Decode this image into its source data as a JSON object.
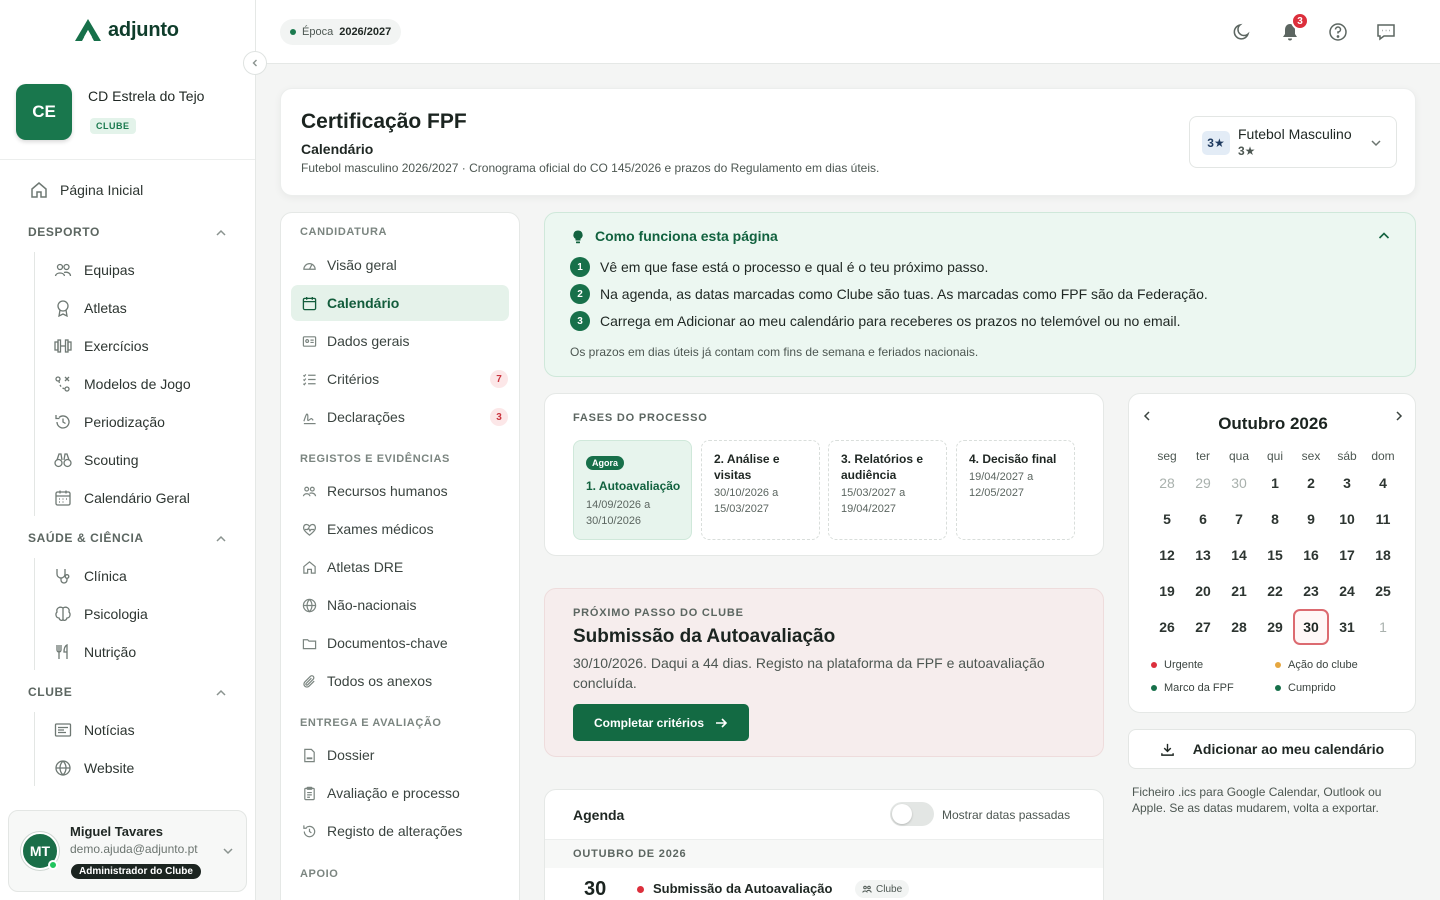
{
  "app": {
    "name": "adjunto"
  },
  "club": {
    "initials": "CE",
    "name": "CD Estrela do Tejo",
    "type": "CLUBE"
  },
  "sidebar": {
    "home": "Página Inicial",
    "sections": [
      {
        "title": "DESPORTO",
        "items": [
          "Equipas",
          "Atletas",
          "Exercícios",
          "Modelos de Jogo",
          "Periodização",
          "Scouting",
          "Calendário Geral"
        ]
      },
      {
        "title": "SAÚDE & CIÊNCIA",
        "items": [
          "Clínica",
          "Psicologia",
          "Nutrição"
        ]
      },
      {
        "title": "CLUBE",
        "items": [
          "Notícias",
          "Website"
        ]
      }
    ]
  },
  "user": {
    "initials": "MT",
    "name": "Miguel Tavares",
    "email": "demo.ajuda@adjunto.pt",
    "role": "Administrador do Clube"
  },
  "topbar": {
    "season_label": "Época",
    "season_value": "2026/2027",
    "notifications": "3"
  },
  "header": {
    "title": "Certificação FPF",
    "subtitle": "Calendário",
    "description": "Futebol masculino 2026/2027 · Cronograma oficial do CO 145/2026 e prazos do Regulamento em dias úteis.",
    "team_badge": "3★",
    "team_name": "Futebol Masculino",
    "team_stars": "3★"
  },
  "subnav": {
    "sections": [
      {
        "title": "CANDIDATURA",
        "items": [
          {
            "label": "Visão geral"
          },
          {
            "label": "Calendário",
            "active": true
          },
          {
            "label": "Dados gerais"
          },
          {
            "label": "Critérios",
            "count": "7"
          },
          {
            "label": "Declarações",
            "count": "3"
          }
        ]
      },
      {
        "title": "REGISTOS E EVIDÊNCIAS",
        "items": [
          {
            "label": "Recursos humanos"
          },
          {
            "label": "Exames médicos"
          },
          {
            "label": "Atletas DRE"
          },
          {
            "label": "Não-nacionais"
          },
          {
            "label": "Documentos-chave"
          },
          {
            "label": "Todos os anexos"
          }
        ]
      },
      {
        "title": "ENTREGA E AVALIAÇÃO",
        "items": [
          {
            "label": "Dossier"
          },
          {
            "label": "Avaliação e processo"
          },
          {
            "label": "Registo de alterações"
          }
        ]
      },
      {
        "title": "APOIO",
        "items": []
      }
    ]
  },
  "info": {
    "title": "Como funciona esta página",
    "steps": [
      "Vê em que fase está o processo e qual é o teu próximo passo.",
      "Na agenda, as datas marcadas como Clube são tuas. As marcadas como FPF são da Federação.",
      "Carrega em Adicionar ao meu calendário para receberes os prazos no telemóvel ou no email."
    ],
    "note": "Os prazos em dias úteis já contam com fins de semana e feriados nacionais."
  },
  "phases": {
    "label": "FASES DO PROCESSO",
    "current_tag": "Agora",
    "items": [
      {
        "title": "1. Autoavaliação",
        "dates": "14/09/2026 a 30/10/2026",
        "current": true
      },
      {
        "title": "2. Análise e visitas",
        "dates": "30/10/2026 a 15/03/2027"
      },
      {
        "title": "3. Relatórios e audiência",
        "dates": "15/03/2027 a 19/04/2027"
      },
      {
        "title": "4. Decisão final",
        "dates": "19/04/2027 a 12/05/2027"
      }
    ]
  },
  "next_step": {
    "label": "PRÓXIMO PASSO DO CLUBE",
    "title": "Submissão da Autoavaliação",
    "description": "30/10/2026. Daqui a 44 dias. Registo na plataforma da FPF e autoavaliação concluída.",
    "button": "Completar critérios"
  },
  "agenda": {
    "title": "Agenda",
    "toggle_label": "Mostrar datas passadas",
    "toggle_on": false,
    "month_label": "OUTUBRO DE 2026",
    "events": [
      {
        "day": "30",
        "title": "Submissão da Autoavaliação",
        "tag": "Clube",
        "color": "#dc2f3c"
      }
    ]
  },
  "calendar": {
    "month": "Outubro 2026",
    "weekdays": [
      "seg",
      "ter",
      "qua",
      "qui",
      "sex",
      "sáb",
      "dom"
    ],
    "weeks": [
      [
        "28",
        "29",
        "30",
        "1",
        "2",
        "3",
        "4"
      ],
      [
        "5",
        "6",
        "7",
        "8",
        "9",
        "10",
        "11"
      ],
      [
        "12",
        "13",
        "14",
        "15",
        "16",
        "17",
        "18"
      ],
      [
        "19",
        "20",
        "21",
        "22",
        "23",
        "24",
        "25"
      ],
      [
        "26",
        "27",
        "28",
        "29",
        "30",
        "31",
        "1"
      ]
    ],
    "muted": [
      [
        0,
        0
      ],
      [
        0,
        1
      ],
      [
        0,
        2
      ],
      [
        4,
        6
      ]
    ],
    "today": [
      4,
      4
    ],
    "legend": [
      {
        "label": "Urgente",
        "color": "#dc2f3c"
      },
      {
        "label": "Ação do clube",
        "color": "#e6a740"
      },
      {
        "label": "Marco da FPF",
        "color": "#17704a"
      },
      {
        "label": "Cumprido",
        "color": "#17704a"
      }
    ]
  },
  "export": {
    "button": "Adicionar ao meu calendário",
    "note": "Ficheiro .ics para Google Calendar, Outlook ou Apple. Se as datas mudarem, volta a exportar."
  }
}
